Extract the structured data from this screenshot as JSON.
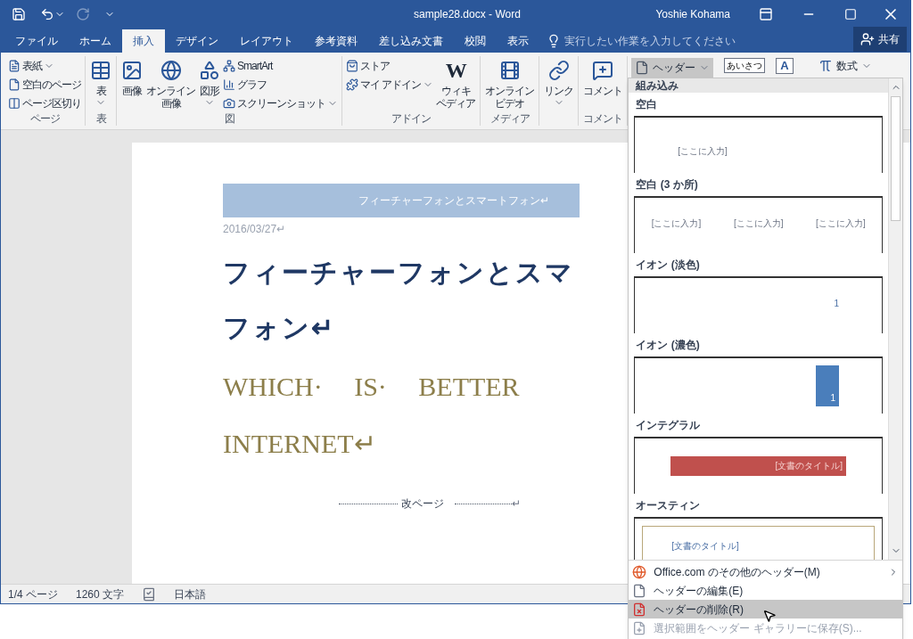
{
  "window": {
    "title": "sample28.docx - Word",
    "user": "Yoshie Kohama"
  },
  "tabs": [
    {
      "label": "ファイル",
      "selected": false
    },
    {
      "label": "ホーム",
      "selected": false
    },
    {
      "label": "挿入",
      "selected": true
    },
    {
      "label": "デザイン",
      "selected": false
    },
    {
      "label": "レイアウト",
      "selected": false
    },
    {
      "label": "参考資料",
      "selected": false
    },
    {
      "label": "差し込み文書",
      "selected": false
    },
    {
      "label": "校閲",
      "selected": false
    },
    {
      "label": "表示",
      "selected": false
    }
  ],
  "tell_me": {
    "placeholder": "実行したい作業を入力してください"
  },
  "share_button": "共有",
  "ribbon": {
    "groups": [
      {
        "label": "ページ",
        "items": [
          {
            "kind": "small",
            "lines": [
              "表紙"
            ],
            "dropdown": true
          },
          {
            "kind": "small",
            "lines": [
              "空白のページ"
            ],
            "dropdown": false
          },
          {
            "kind": "small",
            "lines": [
              "ページ区切り"
            ],
            "dropdown": false
          }
        ]
      },
      {
        "label": "表",
        "items": [
          {
            "kind": "large",
            "lines": [
              "表"
            ],
            "dropdown": true
          }
        ]
      },
      {
        "label": "図",
        "items": [
          {
            "kind": "large",
            "lines": [
              "画像"
            ],
            "dropdown": false
          },
          {
            "kind": "large",
            "lines": [
              "オンライン",
              "画像"
            ],
            "dropdown": false
          },
          {
            "kind": "large",
            "lines": [
              "図形"
            ],
            "dropdown": true
          },
          {
            "kind": "small",
            "lines": [
              "SmartArt"
            ],
            "dropdown": false
          },
          {
            "kind": "small",
            "lines": [
              "グラフ"
            ],
            "dropdown": false
          },
          {
            "kind": "small",
            "lines": [
              "スクリーンショット"
            ],
            "dropdown": true
          }
        ]
      },
      {
        "label": "アドイン",
        "items": [
          {
            "kind": "small",
            "lines": [
              "ストア"
            ],
            "dropdown": false
          },
          {
            "kind": "small",
            "lines": [
              "マイ アドイン"
            ],
            "dropdown": true
          },
          {
            "kind": "large",
            "icon_text": "W",
            "lines": [
              "ウィキ",
              "ペディア"
            ],
            "dropdown": false
          }
        ]
      },
      {
        "label": "メディア",
        "items": [
          {
            "kind": "large",
            "lines": [
              "オンライン",
              "ビデオ"
            ],
            "dropdown": false
          }
        ]
      },
      {
        "items": [
          {
            "kind": "large",
            "lines": [
              "リンク"
            ],
            "dropdown": true
          }
        ]
      },
      {
        "label": "コメント",
        "items": [
          {
            "kind": "large",
            "lines": [
              "コメント"
            ],
            "dropdown": false
          }
        ]
      }
    ],
    "header_button": {
      "label": "ヘッダー",
      "pressed": true
    },
    "greeting_icon_text": "あいさつ",
    "textbox_icon_text": "A",
    "equation_button": "数式"
  },
  "document": {
    "header_text": "フィーチャーフォンとスマートフォン↵",
    "date": "2016/03/27↵",
    "title_lines": [
      "フィーチャーフォンとスマ",
      "フォン↵"
    ],
    "subtitle_lines": [
      "WHICH· IS· BETTER",
      "INTERNET↵"
    ],
    "page_break": "改ページ",
    "page_break_mark": "↵"
  },
  "status_bar": {
    "page": "1/4 ページ",
    "words": "1260 文字",
    "language": "日本語"
  },
  "header_menu": {
    "section": "組み込み",
    "gallery": [
      {
        "name": "空白",
        "kind": "blank",
        "preview_texts": [
          "[ここに入力]"
        ]
      },
      {
        "name": "空白 (3 か所)",
        "kind": "blank3",
        "preview_texts": [
          "[ここに入力]",
          "[ここに入力]",
          "[ここに入力]"
        ]
      },
      {
        "name": "イオン (淡色)",
        "kind": "ion_light",
        "preview_texts": [
          "1"
        ]
      },
      {
        "name": "イオン (濃色)",
        "kind": "ion_dark",
        "preview_texts": [
          "1"
        ]
      },
      {
        "name": "インテグラル",
        "kind": "integral",
        "preview_texts": [
          "[文書のタイトル]"
        ]
      },
      {
        "name": "オースティン",
        "kind": "austin",
        "preview_texts": [
          "[文書のタイトル]"
        ]
      }
    ],
    "commands": [
      {
        "label": "Office.com のその他のヘッダー(M)",
        "submenu": true,
        "selected": false,
        "disabled": false
      },
      {
        "label": "ヘッダーの編集(E)",
        "submenu": false,
        "selected": false,
        "disabled": false
      },
      {
        "label": "ヘッダーの削除(R)",
        "submenu": false,
        "selected": true,
        "disabled": false
      },
      {
        "label": "選択範囲をヘッダー ギャラリーに保存(S)...",
        "submenu": false,
        "selected": false,
        "disabled": true
      }
    ]
  }
}
